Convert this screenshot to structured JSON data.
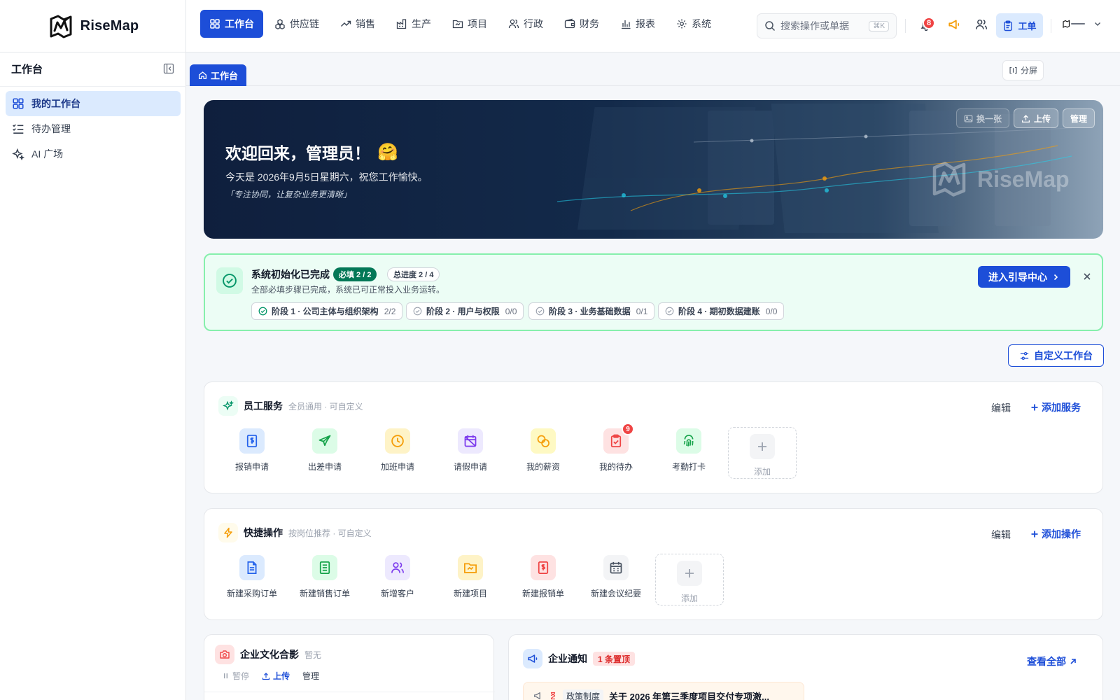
{
  "brand": {
    "name": "RiseMap"
  },
  "nav": {
    "items": [
      {
        "label": "工作台",
        "icon": "grid-icon",
        "active": true
      },
      {
        "label": "供应链",
        "icon": "boxes-icon"
      },
      {
        "label": "销售",
        "icon": "trend-icon"
      },
      {
        "label": "生产",
        "icon": "factory-icon"
      },
      {
        "label": "项目",
        "icon": "folder-icon"
      },
      {
        "label": "行政",
        "icon": "users-icon"
      },
      {
        "label": "财务",
        "icon": "wallet-icon"
      },
      {
        "label": "报表",
        "icon": "bar-chart-icon"
      },
      {
        "label": "系统",
        "icon": "gear-icon"
      }
    ]
  },
  "header": {
    "search_placeholder": "搜索操作或单据",
    "search_shortcut": "⌘K",
    "notification_count": "8",
    "workorder_label": "工单"
  },
  "sidebar": {
    "title": "工作台",
    "items": [
      {
        "label": "我的工作台",
        "icon": "grid-icon",
        "active": true
      },
      {
        "label": "待办管理",
        "icon": "checklist-icon"
      },
      {
        "label": "AI 广场",
        "icon": "sparkle-icon"
      }
    ]
  },
  "tabs": {
    "active_label": "工作台",
    "split_label": "分屏"
  },
  "banner": {
    "greeting": "欢迎回来，管理员！",
    "emoji": "🤗",
    "today": "今天是 2026年9月5日星期六，祝您工作愉快。",
    "motto": "「专注协同，让复杂业务更清晰」",
    "btn_switch": "换一张",
    "btn_upload": "上传",
    "btn_manage": "管理",
    "watermark": "RiseMap"
  },
  "init": {
    "title": "系统初始化已完成",
    "required": "必填 2 / 2",
    "total": "总进度 2 / 4",
    "desc": "全部必填步骤已完成，系统已可正常投入业务运转。",
    "guide_btn": "进入引导中心",
    "stages": [
      {
        "label": "阶段 1 · 公司主体与组织架构",
        "count": "2/2",
        "done": true
      },
      {
        "label": "阶段 2 · 用户与权限",
        "count": "0/0",
        "done": false
      },
      {
        "label": "阶段 3 · 业务基础数据",
        "count": "0/1",
        "done": false
      },
      {
        "label": "阶段 4 · 期初数据建账",
        "count": "0/0",
        "done": false
      }
    ]
  },
  "customize_label": "自定义工作台",
  "employee_services": {
    "title": "员工服务",
    "subtitle": "全员通用 · 可自定义",
    "edit": "编辑",
    "add": "添加服务",
    "items": [
      {
        "label": "报销申请",
        "icon": "receipt-icon",
        "color": "#2563eb"
      },
      {
        "label": "出差申请",
        "icon": "plane-icon",
        "color": "#16a34a"
      },
      {
        "label": "加班申请",
        "icon": "clock-icon",
        "color": "#f59e0b"
      },
      {
        "label": "请假申请",
        "icon": "calendar-off-icon",
        "color": "#7c3aed"
      },
      {
        "label": "我的薪资",
        "icon": "coins-icon",
        "color": "#f59e0b"
      },
      {
        "label": "我的待办",
        "icon": "clipboard-check-icon",
        "color": "#ef4444",
        "badge": "9"
      },
      {
        "label": "考勤打卡",
        "icon": "fingerprint-icon",
        "color": "#16a34a"
      }
    ],
    "add_tile": "添加"
  },
  "quick_actions": {
    "title": "快捷操作",
    "subtitle": "按岗位推荐 · 可自定义",
    "edit": "编辑",
    "add": "添加操作",
    "items": [
      {
        "label": "新建采购订单",
        "icon": "document-icon",
        "color": "#2563eb"
      },
      {
        "label": "新建销售订单",
        "icon": "document-list-icon",
        "color": "#16a34a"
      },
      {
        "label": "新增客户",
        "icon": "users-icon",
        "color": "#7c3aed"
      },
      {
        "label": "新建项目",
        "icon": "folder-icon",
        "color": "#f59e0b"
      },
      {
        "label": "新建报销单",
        "icon": "receipt-icon",
        "color": "#ef4444"
      },
      {
        "label": "新建会议纪要",
        "icon": "calendar-icon",
        "color": "#4b5563"
      }
    ],
    "add_tile": "添加"
  },
  "culture": {
    "title": "企业文化合影",
    "subtitle": "暂无",
    "pause": "暂停",
    "upload": "上传",
    "manage": "管理"
  },
  "notice": {
    "title": "企业通知",
    "pinned": "1 条置顶",
    "view_all": "查看全部",
    "first_category": "政策制度",
    "first_title": "关于 2026 年第三季度项目交付专项激..."
  }
}
